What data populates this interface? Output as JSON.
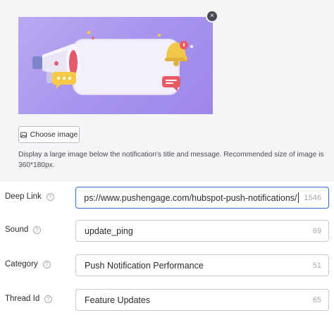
{
  "image_section": {
    "choose_button_label": "Choose image",
    "help_text": "Display a large image below the notification's title and message. Recommended size of image is 360*180px.",
    "close_symbol": "×",
    "image_icon": "image-icon",
    "colors": {
      "card_gradient_start": "#b9a9f2",
      "card_gradient_end": "#9d86e9"
    }
  },
  "fields": {
    "deep_link": {
      "label": "Deep Link",
      "value": "https://www.pushengage.com/hubspot-push-notifications/",
      "count": "1546"
    },
    "sound": {
      "label": "Sound",
      "value": "update_ping",
      "count": "69"
    },
    "category": {
      "label": "Category",
      "value": "Push Notification Performance",
      "count": "51"
    },
    "thread_id": {
      "label": "Thread Id",
      "value": "Feature Updates",
      "count": "65"
    }
  },
  "help_icon_symbol": "?",
  "accent_color": "#2f6fcf"
}
